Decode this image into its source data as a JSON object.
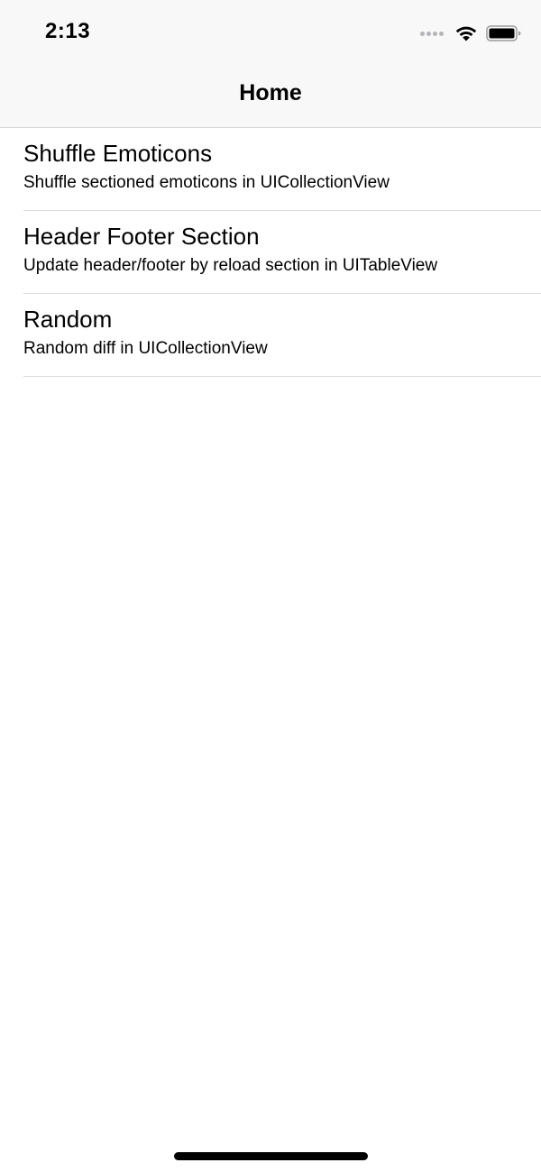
{
  "status_bar": {
    "time": "2:13",
    "signal_icon": "cellular-signal-dots",
    "wifi_icon": "wifi-icon",
    "battery_icon": "battery-full-icon"
  },
  "nav_bar": {
    "title": "Home"
  },
  "list": {
    "items": [
      {
        "title": "Shuffle Emoticons",
        "subtitle": "Shuffle sectioned emoticons in UICollectionView"
      },
      {
        "title": "Header Footer Section",
        "subtitle": "Update header/footer by reload section in UITableView"
      },
      {
        "title": "Random",
        "subtitle": "Random diff in UICollectionView"
      }
    ]
  },
  "colors": {
    "bar_background": "#f8f8f8",
    "separator": "#dcdcde",
    "text": "#000000"
  }
}
